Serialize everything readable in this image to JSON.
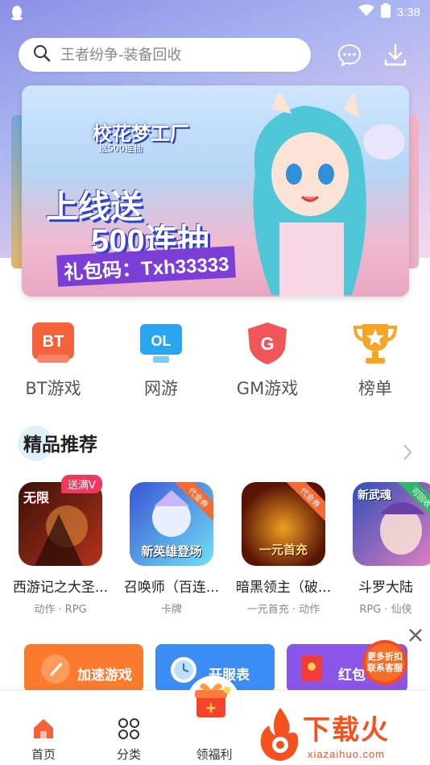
{
  "status_bar": {
    "time": "3:38",
    "app_icon": "qq-penguin-icon",
    "wifi_icon": "wifi-icon",
    "battery_icon": "battery-icon"
  },
  "search": {
    "placeholder": "王者纷争-装备回收",
    "icon": "search-icon"
  },
  "header_actions": [
    {
      "name": "message-icon"
    },
    {
      "name": "download-icon"
    }
  ],
  "banner": {
    "title": "校花梦工厂",
    "subtitle": "送500连抽",
    "line1": "上线送",
    "line2": "500连抽",
    "line3": "礼包码：Txh33333"
  },
  "categories": [
    {
      "label": "BT游戏",
      "icon_text": "BT",
      "color": "#f4613a"
    },
    {
      "label": "网游",
      "icon_text": "OL",
      "color": "#2aa6f0"
    },
    {
      "label": "GM游戏",
      "icon_text": "G",
      "color": "#f0555a"
    },
    {
      "label": "榜单",
      "icon_text": "★",
      "color": "#f7a623"
    }
  ],
  "section": {
    "title": "精品推荐"
  },
  "games": [
    {
      "name": "西游记之大圣...",
      "tags": "动作 · RPG",
      "badge": "送满V",
      "icon_text": "无限",
      "colors": [
        "#3a1208",
        "#b3321a"
      ]
    },
    {
      "name": "召唤师（百连...",
      "tags": "卡牌",
      "corner": "代金券",
      "icon_text": "新英雄登场",
      "colors": [
        "#3b54d6",
        "#6ee0f5"
      ]
    },
    {
      "name": "暗黑领主（破...",
      "tags": "一元首充 · 动作",
      "corner": "代金券",
      "icon_text": "一元首充",
      "colors": [
        "#5a1406",
        "#f0a020"
      ]
    },
    {
      "name": "斗罗大陆",
      "tags": "RPG · 仙侠",
      "corner": "可回收",
      "icon_text": "新武魂",
      "colors": [
        "#2f4fb8",
        "#e47fc0"
      ]
    }
  ],
  "features": [
    {
      "label": "加速游戏",
      "color": "#fb7a2e"
    },
    {
      "label": "开服表",
      "color": "#3c8ef6"
    },
    {
      "label": "红包",
      "color": "#8b56e8"
    }
  ],
  "service_badge": {
    "line1": "更多折扣",
    "line2": "联系客服"
  },
  "bottom_nav": [
    {
      "label": "首页",
      "icon": "home-icon"
    },
    {
      "label": "分类",
      "icon": "grid-icon"
    },
    {
      "label": "领福利",
      "icon": "gift-icon"
    }
  ],
  "watermark": {
    "text": "下载火",
    "url": "xiazaihuo.com"
  }
}
